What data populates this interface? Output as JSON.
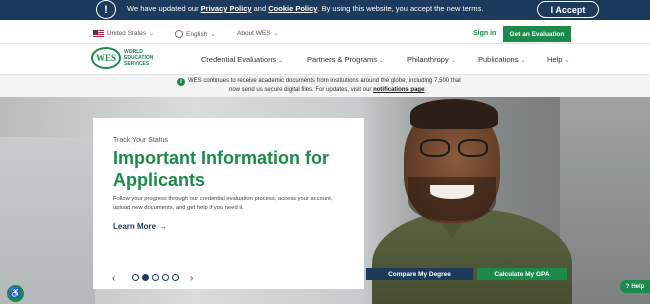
{
  "cookie_banner": {
    "text_before": "We have updated our ",
    "privacy_link": "Privacy Policy",
    "and": " and ",
    "cookie_link": "Cookie Policy",
    "text_after": ". By using this website, you accept the new terms.",
    "accept_label": "I Accept",
    "info_icon": "info-icon"
  },
  "utility_bar": {
    "country": "United States",
    "language": "English",
    "about": "About WES",
    "sign_in": "Sign in",
    "get_evaluation": "Get an Evaluation"
  },
  "logo": {
    "mark": "WES",
    "line1": "WORLD",
    "line2": "EDUCATION",
    "line3": "SERVICES"
  },
  "nav": {
    "items": [
      {
        "label": "Credential Evaluations"
      },
      {
        "label": "Partners & Programs"
      },
      {
        "label": "Philanthropy"
      },
      {
        "label": "Publications"
      },
      {
        "label": "Help"
      }
    ]
  },
  "notice": {
    "line1": "WES continues to receive academic documents from institutions around the globe, including 7,500 that",
    "line2_before": "now send us secure digital files. For updates, visit our ",
    "link": "notifications page",
    "line2_after": "."
  },
  "hero": {
    "eyebrow": "Track Your Status",
    "title": "Important Information for Applicants",
    "description": "Follow your progress through our credential evaluation process, access your account, upload new documents, and get help if you need it.",
    "learn_more": "Learn More",
    "carousel": {
      "slide_count": 5,
      "active_index": 1
    }
  },
  "ctas": {
    "compare": "Compare My Degree",
    "calculate": "Calculate My GPA"
  },
  "help_button": "Help",
  "colors": {
    "navy": "#1c3a5c",
    "green": "#1b8a4a"
  }
}
